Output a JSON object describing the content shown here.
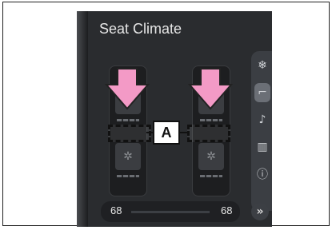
{
  "screen": {
    "title": "Seat Climate",
    "bottom_left_temp": "68",
    "bottom_right_temp": "68",
    "next_label": "»"
  },
  "sidebar": {
    "items": [
      {
        "icon": "seat-fan-icon",
        "glyph": "❄"
      },
      {
        "icon": "seat-icon",
        "glyph": "⌐"
      },
      {
        "icon": "music-note-icon",
        "glyph": "♪"
      },
      {
        "icon": "bar-chart-icon",
        "glyph": "▥"
      },
      {
        "icon": "info-icon",
        "glyph": "ⓘ"
      }
    ]
  },
  "callout": {
    "label": "A"
  },
  "colors": {
    "arrow_fill": "#f39ac6",
    "arrow_stroke": "#222222",
    "screen_bg": "#2a2c2f"
  }
}
